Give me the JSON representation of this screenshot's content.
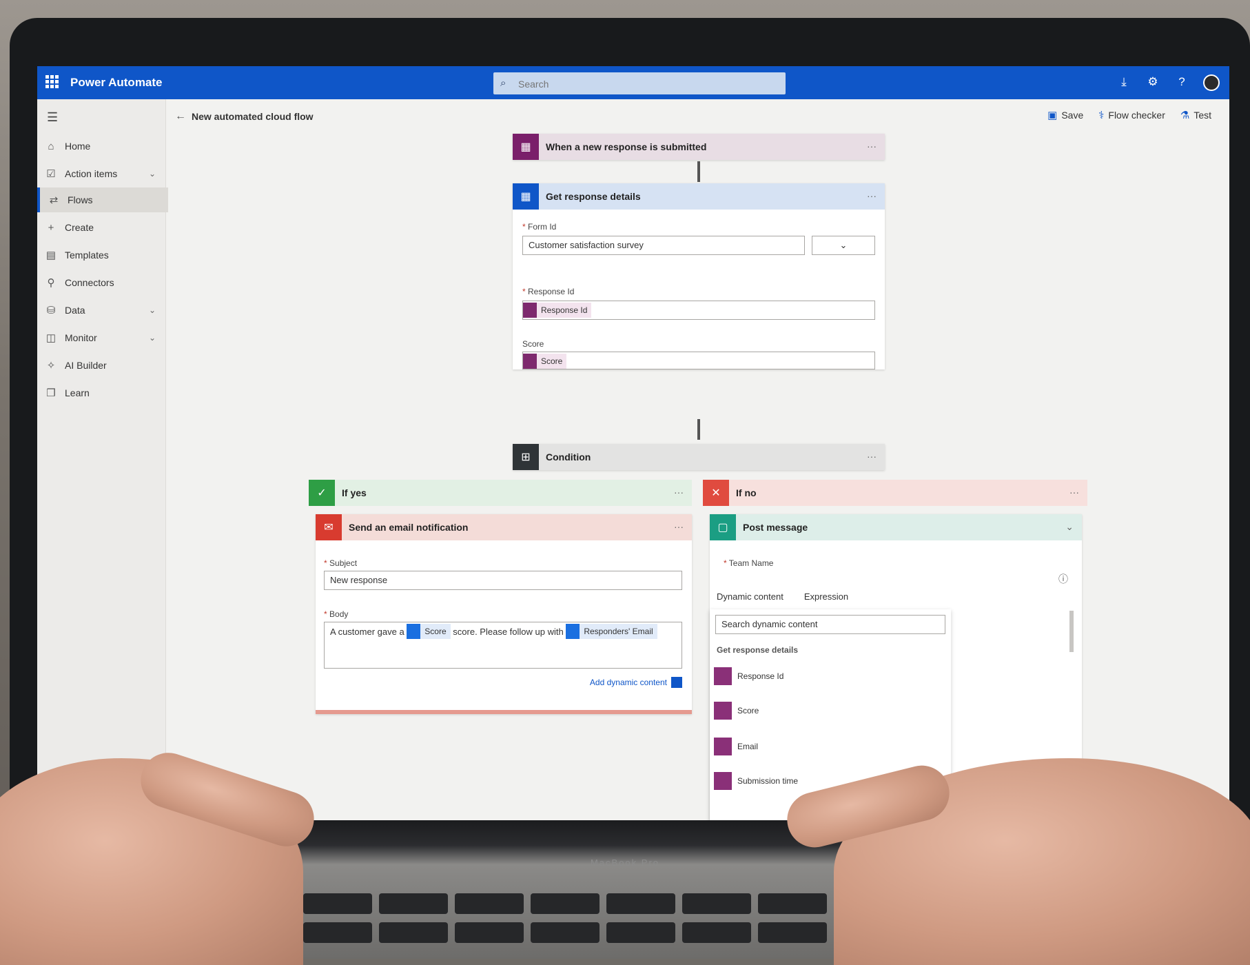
{
  "topbar": {
    "app_name": "Power Automate",
    "search_placeholder": "Search",
    "icons": [
      "waffle-icon",
      "search-icon",
      "download-icon",
      "settings-icon",
      "help-icon",
      "avatar"
    ]
  },
  "sidebar": {
    "items": [
      {
        "label": "Home",
        "icon": "home-icon",
        "chevron": false
      },
      {
        "label": "Action items",
        "icon": "checklist-icon",
        "chevron": true
      },
      {
        "label": "Flows",
        "icon": "flow-icon",
        "chevron": false,
        "active": true
      },
      {
        "label": "Create",
        "icon": "plus-icon",
        "chevron": false
      },
      {
        "label": "Templates",
        "icon": "template-icon",
        "chevron": false
      },
      {
        "label": "Connectors",
        "icon": "connector-icon",
        "chevron": false
      },
      {
        "label": "Data",
        "icon": "database-icon",
        "chevron": true
      },
      {
        "label": "Monitor",
        "icon": "monitor-icon",
        "chevron": true
      },
      {
        "label": "AI Builder",
        "icon": "ai-icon",
        "chevron": false
      },
      {
        "label": "Learn",
        "icon": "book-icon",
        "chevron": false
      }
    ]
  },
  "breadcrumb": {
    "title": "New automated cloud flow"
  },
  "commands": {
    "save": "Save",
    "flow_checker": "Flow checker",
    "test": "Test"
  },
  "steps": {
    "trigger": {
      "title": "When a new response is submitted",
      "color": "#7a1f6a"
    },
    "get_details": {
      "title": "Get response details",
      "color": "#0f56c8",
      "form_label": "Form Id",
      "form_value": "Customer satisfaction survey",
      "response_label": "Response Id",
      "response_token": "Response Id",
      "score_label": "Score",
      "score_token": "Score"
    },
    "condition": {
      "title": "Condition",
      "color": "#2f3437"
    }
  },
  "branches": {
    "yes": {
      "label": "If yes",
      "color": "#2e9e45"
    },
    "no": {
      "label": "If no",
      "color": "#e04b3f"
    }
  },
  "email_card": {
    "title": "Send an email notification",
    "color": "#d83b2f",
    "subject_label": "Subject",
    "subject_value": "New response",
    "body_label": "Body",
    "body_prefix": "A customer gave a",
    "body_token_1": "Score",
    "body_mid": "score. Please follow up with",
    "body_token_2": "Responders' Email",
    "add_dynamic": "Add dynamic content"
  },
  "post_card": {
    "title": "Post message",
    "color": "#1b9e83",
    "team_label": "Team Name",
    "tab_dynamic": "Dynamic content",
    "tab_expression": "Expression",
    "dynamic_search": "Search dynamic content",
    "section_label": "Get response details",
    "items": [
      "Response Id",
      "Score",
      "Email",
      "Submission time"
    ]
  },
  "laptop": {
    "brand": "MacBook Pro"
  }
}
